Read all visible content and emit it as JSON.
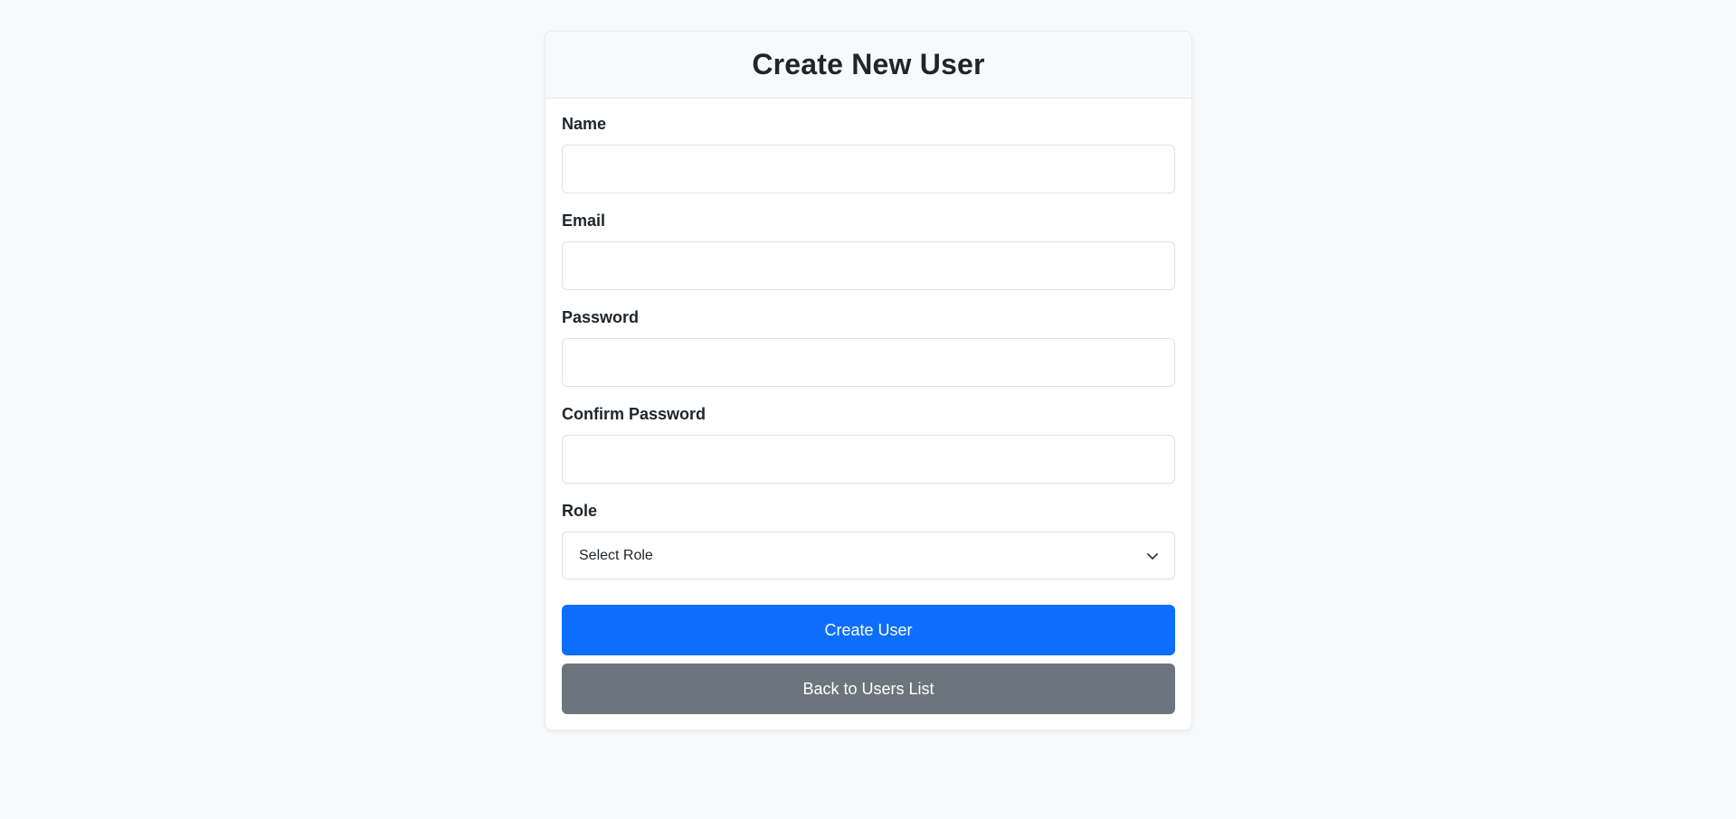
{
  "header": {
    "title": "Create New User"
  },
  "form": {
    "name": {
      "label": "Name",
      "value": "",
      "placeholder": ""
    },
    "email": {
      "label": "Email",
      "value": "",
      "placeholder": ""
    },
    "password": {
      "label": "Password",
      "value": "",
      "placeholder": ""
    },
    "confirm_password": {
      "label": "Confirm Password",
      "value": "",
      "placeholder": ""
    },
    "role": {
      "label": "Role",
      "selected": "Select Role"
    }
  },
  "buttons": {
    "create_label": "Create User",
    "back_label": "Back to Users List"
  },
  "colors": {
    "primary": "#0d6efd",
    "secondary": "#6c757d",
    "background": "#f8f9fa"
  },
  "icons": {
    "select": "chevron-down-icon"
  }
}
